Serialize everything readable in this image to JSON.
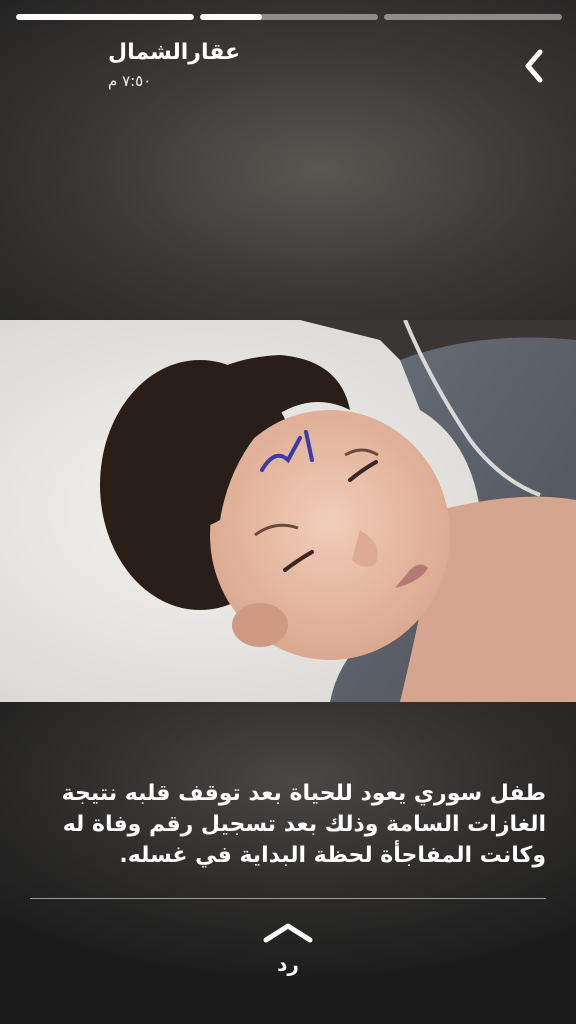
{
  "story": {
    "progress_segments": [
      {
        "fill": 1.0
      },
      {
        "fill": 0.35
      },
      {
        "fill": 0.0
      }
    ]
  },
  "header": {
    "username": "عقارالشمال",
    "timestamp": "٧:٥٠ م",
    "back_icon": "chevron-right-icon"
  },
  "caption": {
    "text": "طفل سوري يعود للحياة بعد توقف قلبه نتيجة\nالغازات السامة وذلك بعد تسجيل رقم وفاة له\nوكانت المفاجأة لحظة البداية في غسله."
  },
  "photo": {
    "forehead_mark": "٧"
  },
  "reply": {
    "label": "رد",
    "icon": "chevron-up-icon"
  },
  "colors": {
    "background": "#1a1a1a",
    "text": "#ffffff",
    "progress_fill": "#ffffff",
    "progress_track": "#8a8a8a",
    "ink_mark": "#3a3aa8"
  }
}
